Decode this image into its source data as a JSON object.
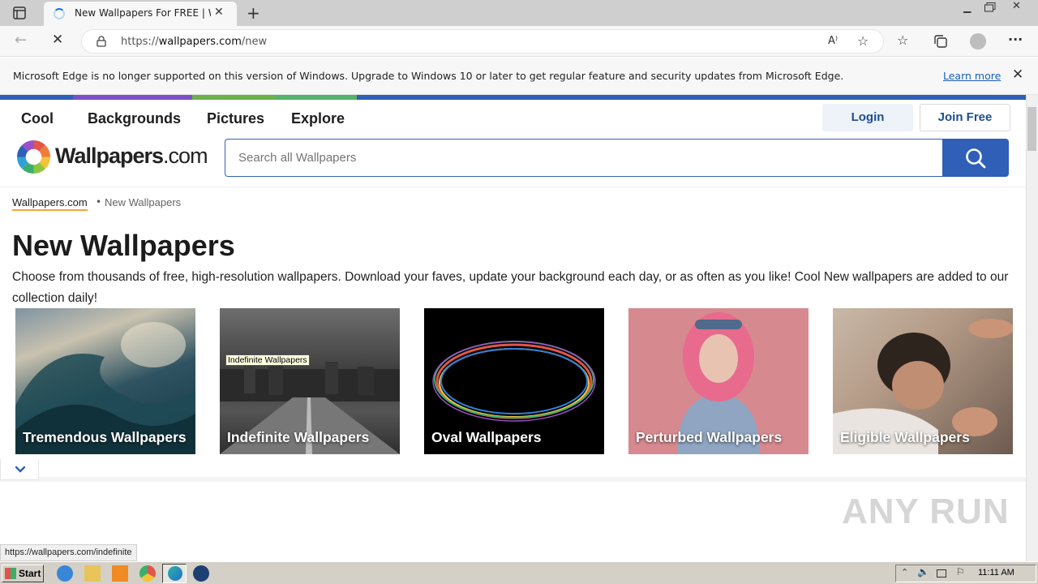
{
  "browser": {
    "tab_title": "New Wallpapers For FREE | Wall",
    "url_prefix": "https://",
    "url_host": "wallpapers.com",
    "url_path": "/new",
    "status_url": "https://wallpapers.com/indefinite"
  },
  "infobar": {
    "message": "Microsoft Edge is no longer supported on this version of Windows. Upgrade to Windows 10 or later to get regular feature and security updates from Microsoft Edge.",
    "learn_more": "Learn more"
  },
  "site": {
    "colorbar": [
      "#2f5fb7",
      "#7b4fc9",
      "#6cb04a",
      "#f2a541",
      "#e2554a"
    ],
    "nav": [
      "Cool",
      "Backgrounds",
      "Pictures",
      "Explore"
    ],
    "login": "Login",
    "join": "Join Free",
    "logo_bold": "Wallpapers",
    "logo_light": ".com",
    "search_placeholder": "Search all Wallpapers",
    "accent": "#2f5fb7"
  },
  "breadcrumb": {
    "home": "Wallpapers.com",
    "current": "New Wallpapers"
  },
  "page": {
    "title": "New Wallpapers",
    "description": "Choose from thousands of free, high-resolution wallpapers. Download your faves, update your background each day, or as often as you like! Cool New wallpapers are added to our collection daily!"
  },
  "cards": [
    {
      "label": "Tremendous Wallpapers"
    },
    {
      "label": "Indefinite Wallpapers"
    },
    {
      "label": "Oval Wallpapers"
    },
    {
      "label": "Perturbed Wallpapers"
    },
    {
      "label": "Eligible Wallpapers"
    }
  ],
  "tooltip": "Indefinite Wallpapers",
  "watermark": "ANY RUN",
  "taskbar": {
    "start": "Start",
    "clock": "11:11 AM"
  }
}
